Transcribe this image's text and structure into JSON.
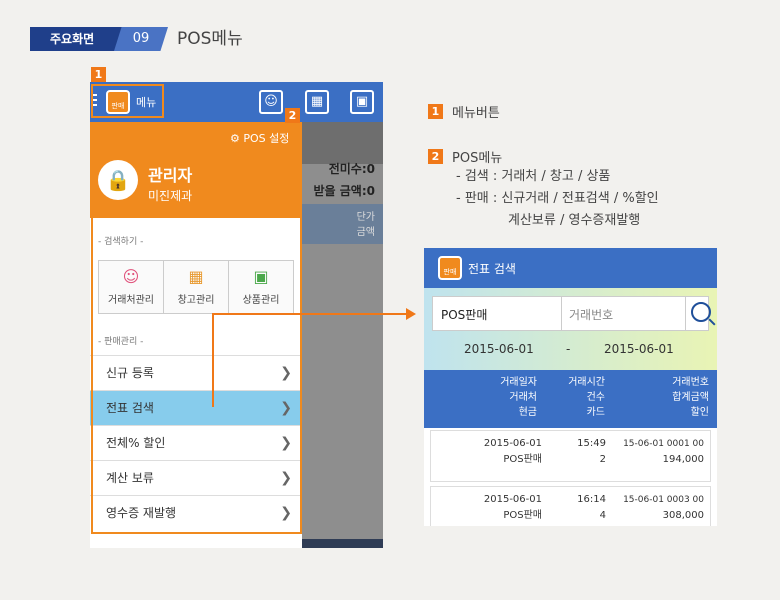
{
  "header": {
    "badge": "주요화면",
    "number": "09",
    "title": "POS메뉴"
  },
  "phone": {
    "topbar": {
      "menu_label": "메뉴",
      "logo_text": "판매POS"
    },
    "background": {
      "unpaid": "전미수:0",
      "receive": "받을 금액:0",
      "col1": "단가",
      "col2": "금액"
    },
    "drawer": {
      "pos_settings": "POS 설정",
      "user_role": "관리자",
      "shop_name": "미진제과",
      "search_section": "- 검색하기 -",
      "search_items": [
        {
          "label": "거래처관리",
          "icon": "person-icon"
        },
        {
          "label": "창고관리",
          "icon": "warehouse-icon"
        },
        {
          "label": "상품관리",
          "icon": "boxes-icon"
        }
      ],
      "sales_section": "- 판매관리 -",
      "menu_items": [
        "신규 등록",
        "전표 검색",
        "전체% 할인",
        "계산 보류",
        "영수증 재발행"
      ],
      "selected_index": 1
    }
  },
  "legend": {
    "item1_num": "1",
    "item1": "메뉴버튼",
    "item2_num": "2",
    "item2": "POS메뉴",
    "sub1": "- 검색 : 거래처 / 창고 / 상품",
    "sub2": "- 판매 : 신규거래 / 전표검색 / %할인",
    "sub3": "계산보류 / 영수증재발행"
  },
  "callouts": {
    "one": "1",
    "two": "2"
  },
  "card": {
    "title": "전표 검색",
    "logo_text": "판매POS",
    "search": {
      "type_value": "POS판매",
      "placeholder": "거래번호"
    },
    "date_from": "2015-06-01",
    "date_sep": "-",
    "date_to": "2015-06-01",
    "headers": {
      "c1": [
        "거래일자",
        "거래처",
        "현금"
      ],
      "c2": [
        "거래시간",
        "건수",
        "카드"
      ],
      "c3": [
        "거래번호",
        "합계금액",
        "할인"
      ]
    },
    "rows": [
      {
        "date": "2015-06-01",
        "client": "POS판매",
        "time": "15:49",
        "count": "2",
        "no": "15-06-01 0001 00",
        "total": "194,000"
      },
      {
        "date": "2015-06-01",
        "client": "POS판매",
        "time": "16:14",
        "count": "4",
        "no": "15-06-01 0003 00",
        "total": "308,000"
      }
    ]
  },
  "colors": {
    "accent": "#f08a1e",
    "blue": "#3b6fc4",
    "navy": "#1f3f8a",
    "selected": "#87ccec"
  }
}
